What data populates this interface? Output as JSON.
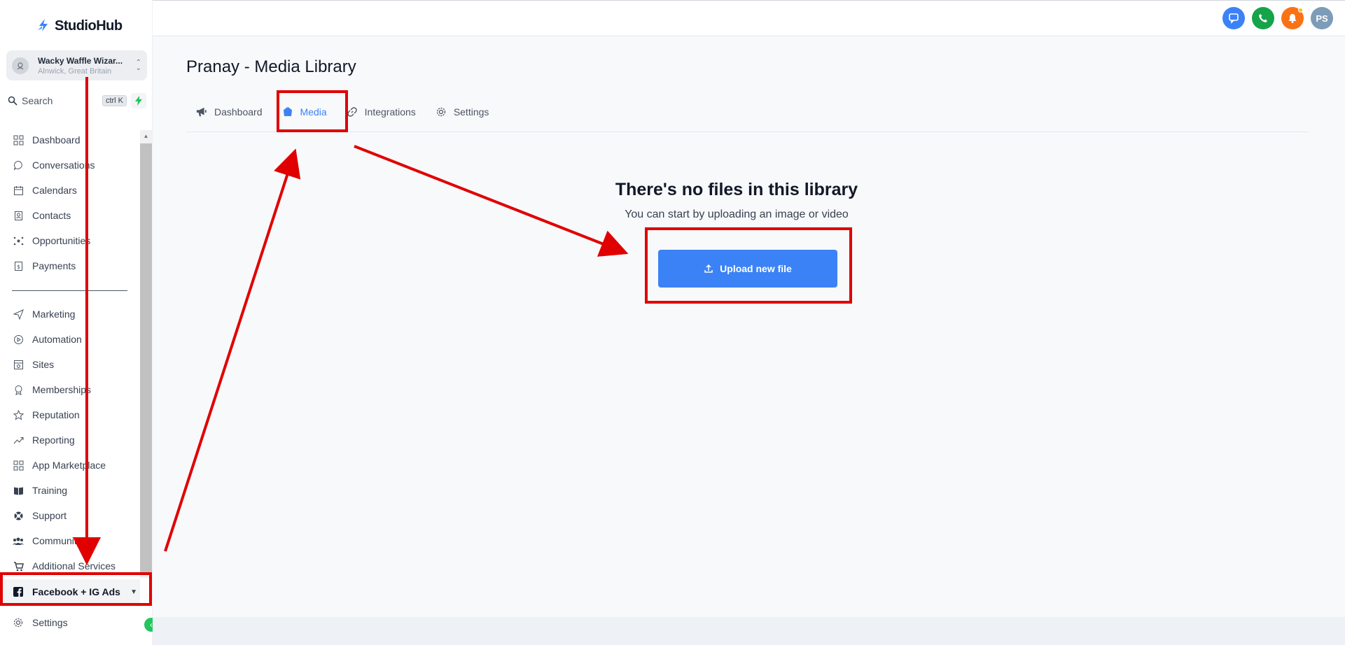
{
  "brand": {
    "name": "StudioHub",
    "accent": "#3b82f6"
  },
  "location": {
    "name": "Wacky Waffle Wizar...",
    "sub": "Alnwick, Great Britain"
  },
  "search": {
    "label": "Search",
    "shortcut": "ctrl K"
  },
  "sidebar": {
    "items_top": [
      {
        "label": "Dashboard",
        "icon": "grid-icon"
      },
      {
        "label": "Conversations",
        "icon": "chat-icon"
      },
      {
        "label": "Calendars",
        "icon": "calendar-icon"
      },
      {
        "label": "Contacts",
        "icon": "contacts-icon"
      },
      {
        "label": "Opportunities",
        "icon": "opportunities-icon"
      },
      {
        "label": "Payments",
        "icon": "payments-icon"
      }
    ],
    "items_bottom": [
      {
        "label": "Marketing",
        "icon": "send-icon"
      },
      {
        "label": "Automation",
        "icon": "automation-icon"
      },
      {
        "label": "Sites",
        "icon": "sites-icon"
      },
      {
        "label": "Memberships",
        "icon": "badge-icon"
      },
      {
        "label": "Reputation",
        "icon": "star-icon"
      },
      {
        "label": "Reporting",
        "icon": "trend-icon"
      },
      {
        "label": "App Marketplace",
        "icon": "grid-icon"
      },
      {
        "label": "Training",
        "icon": "book-icon"
      },
      {
        "label": "Support",
        "icon": "lifebuoy-icon"
      },
      {
        "label": "Community",
        "icon": "people-icon"
      },
      {
        "label": "Additional Services",
        "icon": "cart-icon"
      }
    ],
    "active_item": "Facebook + IG Ads",
    "settings": "Settings"
  },
  "topbar": {
    "avatar_initials": "PS"
  },
  "page": {
    "title": "Pranay - Media Library",
    "tabs": [
      {
        "label": "Dashboard",
        "icon": "megaphone-icon"
      },
      {
        "label": "Media",
        "icon": "bucket-icon"
      },
      {
        "label": "Integrations",
        "icon": "link-icon"
      },
      {
        "label": "Settings",
        "icon": "gear-icon"
      }
    ],
    "active_tab": "Media",
    "empty_title": "There's no files in this library",
    "empty_subtitle": "You can start by uploading an image or video",
    "upload_label": "Upload new file"
  },
  "colors": {
    "primary": "#3b82f6",
    "annotation": "#e00000",
    "chat": "#3b82f6",
    "phone": "#16a34a",
    "bell": "#f97316",
    "avatar": "#7c9cb8"
  }
}
